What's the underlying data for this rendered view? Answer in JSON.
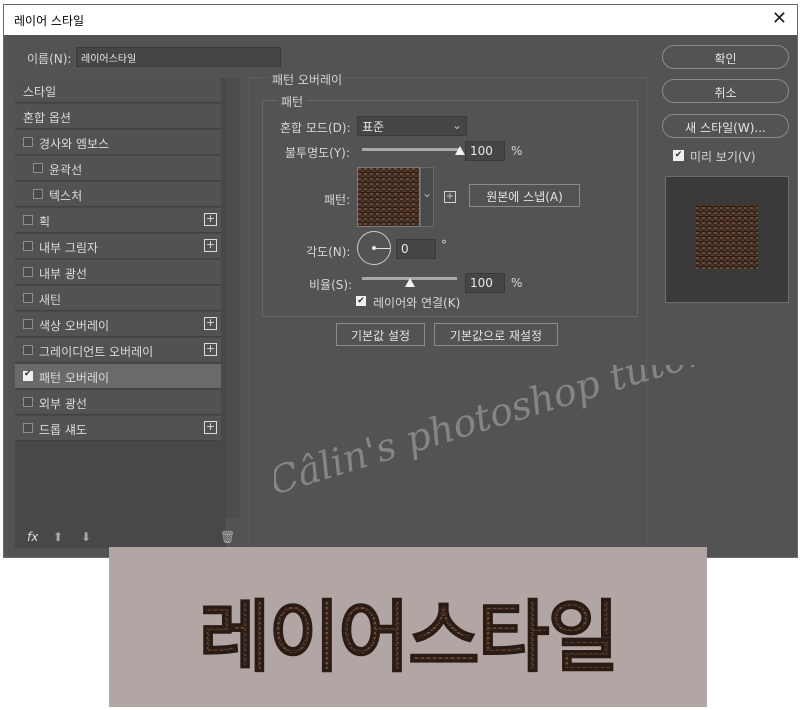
{
  "window": {
    "title": "레이어 스타일",
    "close_icon": "close-icon"
  },
  "name_field": {
    "label": "이름(N):",
    "value": "레이어스타일"
  },
  "style_list": {
    "items": [
      {
        "label": "스타일",
        "checkbox": false,
        "plus": false,
        "selected": false,
        "indent": 0
      },
      {
        "label": "혼합 옵션",
        "checkbox": false,
        "plus": false,
        "selected": false,
        "indent": 0
      },
      {
        "label": "경사와 엠보스",
        "checkbox": true,
        "checked": false,
        "plus": false,
        "selected": false,
        "indent": 0
      },
      {
        "label": "윤곽선",
        "checkbox": true,
        "checked": false,
        "plus": false,
        "selected": false,
        "indent": 1
      },
      {
        "label": "텍스처",
        "checkbox": true,
        "checked": false,
        "plus": false,
        "selected": false,
        "indent": 1
      },
      {
        "label": "획",
        "checkbox": true,
        "checked": false,
        "plus": true,
        "selected": false,
        "indent": 0
      },
      {
        "label": "내부 그림자",
        "checkbox": true,
        "checked": false,
        "plus": true,
        "selected": false,
        "indent": 0
      },
      {
        "label": "내부 광선",
        "checkbox": true,
        "checked": false,
        "plus": false,
        "selected": false,
        "indent": 0
      },
      {
        "label": "새틴",
        "checkbox": true,
        "checked": false,
        "plus": false,
        "selected": false,
        "indent": 0
      },
      {
        "label": "색상 오버레이",
        "checkbox": true,
        "checked": false,
        "plus": true,
        "selected": false,
        "indent": 0
      },
      {
        "label": "그레이디언트 오버레이",
        "checkbox": true,
        "checked": false,
        "plus": true,
        "selected": false,
        "indent": 0
      },
      {
        "label": "패턴 오버레이",
        "checkbox": true,
        "checked": true,
        "plus": false,
        "selected": true,
        "indent": 0
      },
      {
        "label": "외부 광선",
        "checkbox": true,
        "checked": false,
        "plus": false,
        "selected": false,
        "indent": 0
      },
      {
        "label": "드롭 섀도",
        "checkbox": true,
        "checked": false,
        "plus": true,
        "selected": false,
        "indent": 0
      }
    ],
    "bottom_icons": {
      "fx": "fx",
      "up": "up-arrow-icon",
      "down": "down-arrow-icon",
      "trash": "trash-icon"
    }
  },
  "pattern_overlay": {
    "section_title": "패턴 오버레이",
    "group_title": "패턴",
    "blend_mode": {
      "label": "혼합 모드(D):",
      "value": "표준"
    },
    "opacity": {
      "label": "불투명도(Y):",
      "value": "100",
      "unit": "%",
      "level": 1.0
    },
    "pattern": {
      "label": "패턴:",
      "snap_button": "원본에 스냅(A)",
      "new_preset_icon": "new-preset-icon"
    },
    "angle": {
      "label": "각도(N):",
      "value": "0",
      "unit": "°"
    },
    "scale": {
      "label": "비율(S):",
      "value": "100",
      "unit": "%",
      "level": 0.5
    },
    "link": {
      "label": "레이어와 연결(K)",
      "checked": true
    },
    "buttons": {
      "make_default": "기본값 설정",
      "reset_default": "기본값으로 재설정"
    }
  },
  "right_panel": {
    "ok": "확인",
    "cancel": "취소",
    "new_style": "새 스타일(W)...",
    "preview": {
      "label": "미리 보기(V)",
      "checked": true
    }
  },
  "watermark": "Câlin's photoshop tutorial",
  "banner": {
    "text": "레이어스타일"
  },
  "colors": {
    "dialog_bg": "#535353",
    "pattern_dark": "#3a2a20",
    "pattern_light": "#6a4a38",
    "banner_bg": "#b1a6a4"
  }
}
